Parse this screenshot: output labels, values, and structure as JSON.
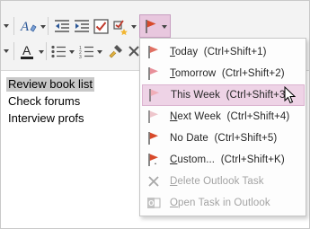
{
  "toolbar": {
    "row1_icons": [
      "clear-formatting-icon",
      "outdent-icon",
      "to-do-checkbox-icon",
      "tag-icon",
      "outlook-flag-icon"
    ],
    "row2_icons": [
      "font-color-icon",
      "bullets-icon",
      "numbering-icon",
      "format-painter-icon",
      "delete-icon"
    ],
    "flag_button_color": "#d84a2b",
    "active_highlight": "#e8c7de"
  },
  "note": {
    "lines": [
      {
        "text": "Review book list",
        "selected": true
      },
      {
        "text": "Check forums",
        "selected": false
      },
      {
        "text": "Interview profs",
        "selected": false
      }
    ]
  },
  "menu": {
    "items": [
      {
        "access": "T",
        "rest": "oday",
        "shortcut": "(Ctrl+Shift+1)",
        "icon": "flag-red-icon",
        "flag_color": "#e07063",
        "enabled": true
      },
      {
        "access": "T",
        "rest": "omorrow",
        "shortcut": "(Ctrl+Shift+2)",
        "icon": "flag-red-icon",
        "flag_color": "#e8909a",
        "enabled": true
      },
      {
        "access": "",
        "rest": "This Week",
        "shortcut": "(Ctrl+Shift+3)",
        "icon": "flag-pink-icon",
        "flag_color": "#f0aeb8",
        "enabled": true,
        "highlighted": true
      },
      {
        "access": "N",
        "rest": "ext Week",
        "shortcut": "(Ctrl+Shift+4)",
        "icon": "flag-pink-icon",
        "flag_color": "#eec6cc",
        "enabled": true
      },
      {
        "access": "",
        "rest": "No Date",
        "shortcut": "(Ctrl+Shift+5)",
        "icon": "flag-red-icon",
        "flag_color": "#d84a2b",
        "enabled": true
      },
      {
        "access": "C",
        "rest": "ustom...",
        "shortcut": "(Ctrl+Shift+K)",
        "icon": "flag-custom-icon",
        "flag_color": "#d84a2b",
        "enabled": true
      },
      {
        "access": "D",
        "rest": "elete Outlook Task",
        "shortcut": "",
        "icon": "delete-x-icon",
        "enabled": false
      },
      {
        "access": "O",
        "rest": "pen Task in Outlook",
        "shortcut": "",
        "icon": "outlook-icon",
        "enabled": false
      }
    ]
  }
}
